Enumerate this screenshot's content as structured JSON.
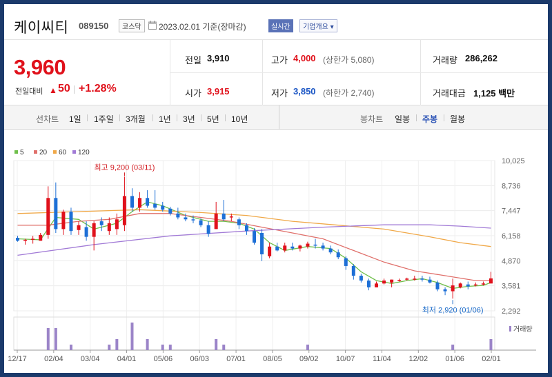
{
  "header": {
    "name": "케이씨티",
    "code": "089150",
    "market": "코스닥",
    "date": "2023.02.01 기준(장마감)",
    "realtime_label": "실시간",
    "company_label": "기업개요"
  },
  "summary": {
    "price": "3,960",
    "change_label": "전일대비",
    "change_value": "50",
    "change_pct": "+1.28%",
    "prev_close_label": "전일",
    "prev_close": "3,910",
    "high_label": "고가",
    "high": "4,000",
    "upper_limit": "(상한가 5,080)",
    "volume_label": "거래량",
    "volume": "286,262",
    "open_label": "시가",
    "open": "3,915",
    "low_label": "저가",
    "low": "3,850",
    "lower_limit": "(하한가 2,740)",
    "amount_label": "거래대금",
    "amount": "1,125 백만"
  },
  "range_bar": {
    "line_label": "선차트",
    "line_options": [
      "1일",
      "1주일",
      "3개월",
      "1년",
      "3년",
      "5년",
      "10년"
    ],
    "candle_label": "봉차트",
    "candle_options": [
      "일봉",
      "주봉",
      "월봉"
    ],
    "active_candle": "주봉"
  },
  "colors": {
    "up": "#e0111b",
    "down": "#1d6fd6",
    "ma5": "#6fbf4a",
    "ma20": "#e0706b",
    "ma60": "#f0a848",
    "ma120": "#a17ad6",
    "volume": "#9b84c8"
  },
  "chart_data": {
    "type": "candlestick",
    "legend": [
      "5",
      "20",
      "60",
      "120"
    ],
    "y_ticks": [
      "10,025",
      "8,736",
      "7,447",
      "6,158",
      "4,870",
      "3,581",
      "2,292"
    ],
    "ylim": [
      2292,
      10025
    ],
    "x_ticks": [
      "12/17",
      "02/04",
      "03/04",
      "04/01",
      "05/06",
      "06/03",
      "07/01",
      "08/05",
      "09/02",
      "10/07",
      "11/04",
      "12/02",
      "01/06",
      "02/01"
    ],
    "annotation_high": "최고 9,200 (03/11)",
    "annotation_low": "최저 2,920 (01/06)",
    "volume_label": "거래량",
    "candles": [
      {
        "o": 6050,
        "h": 6150,
        "l": 5850,
        "c": 5900
      },
      {
        "o": 5900,
        "h": 6000,
        "l": 5700,
        "c": 5950
      },
      {
        "o": 5950,
        "h": 6150,
        "l": 5750,
        "c": 6000
      },
      {
        "o": 5900,
        "h": 6300,
        "l": 5900,
        "c": 6200
      },
      {
        "o": 6200,
        "h": 8700,
        "l": 6000,
        "c": 8100
      },
      {
        "o": 8100,
        "h": 8900,
        "l": 6300,
        "c": 6500
      },
      {
        "o": 6500,
        "h": 7500,
        "l": 6200,
        "c": 7400
      },
      {
        "o": 7400,
        "h": 7600,
        "l": 6200,
        "c": 6400
      },
      {
        "o": 6450,
        "h": 6900,
        "l": 6200,
        "c": 6700
      },
      {
        "o": 6600,
        "h": 6900,
        "l": 5900,
        "c": 6100
      },
      {
        "o": 6100,
        "h": 6900,
        "l": 5400,
        "c": 6800
      },
      {
        "o": 6900,
        "h": 7100,
        "l": 6400,
        "c": 6700
      },
      {
        "o": 6400,
        "h": 7100,
        "l": 6200,
        "c": 6800
      },
      {
        "o": 6500,
        "h": 7300,
        "l": 6200,
        "c": 7000
      },
      {
        "o": 6700,
        "h": 9200,
        "l": 6400,
        "c": 8200
      },
      {
        "o": 8200,
        "h": 8600,
        "l": 7400,
        "c": 7600
      },
      {
        "o": 7600,
        "h": 8400,
        "l": 7400,
        "c": 8100
      },
      {
        "o": 8100,
        "h": 8500,
        "l": 7600,
        "c": 7700
      },
      {
        "o": 7800,
        "h": 8500,
        "l": 7500,
        "c": 7600
      },
      {
        "o": 7700,
        "h": 7900,
        "l": 7400,
        "c": 7500
      },
      {
        "o": 7550,
        "h": 7650,
        "l": 7200,
        "c": 7300
      },
      {
        "o": 7300,
        "h": 7600,
        "l": 7000,
        "c": 7100
      },
      {
        "o": 7100,
        "h": 7300,
        "l": 6900,
        "c": 7000
      },
      {
        "o": 7000,
        "h": 7200,
        "l": 6800,
        "c": 6950
      },
      {
        "o": 6950,
        "h": 7050,
        "l": 6600,
        "c": 6700
      },
      {
        "o": 6700,
        "h": 6900,
        "l": 6100,
        "c": 6250
      },
      {
        "o": 6500,
        "h": 7900,
        "l": 6500,
        "c": 7300
      },
      {
        "o": 7300,
        "h": 8000,
        "l": 6900,
        "c": 7000
      },
      {
        "o": 7100,
        "h": 7300,
        "l": 6900,
        "c": 7150
      },
      {
        "o": 7000,
        "h": 7100,
        "l": 6500,
        "c": 6700
      },
      {
        "o": 6700,
        "h": 6800,
        "l": 6200,
        "c": 6400
      },
      {
        "o": 6400,
        "h": 6550,
        "l": 5700,
        "c": 5800
      },
      {
        "o": 6300,
        "h": 6500,
        "l": 4850,
        "c": 5200
      },
      {
        "o": 5100,
        "h": 5800,
        "l": 5000,
        "c": 5600
      },
      {
        "o": 5600,
        "h": 5800,
        "l": 5350,
        "c": 5400
      },
      {
        "o": 5400,
        "h": 5800,
        "l": 5300,
        "c": 5650
      },
      {
        "o": 5600,
        "h": 5800,
        "l": 5400,
        "c": 5500
      },
      {
        "o": 5500,
        "h": 5700,
        "l": 5350,
        "c": 5650
      },
      {
        "o": 5600,
        "h": 5850,
        "l": 5500,
        "c": 5750
      },
      {
        "o": 5700,
        "h": 6000,
        "l": 5500,
        "c": 5650
      },
      {
        "o": 5650,
        "h": 5800,
        "l": 5400,
        "c": 5500
      },
      {
        "o": 5500,
        "h": 5650,
        "l": 5200,
        "c": 5300
      },
      {
        "o": 5300,
        "h": 5450,
        "l": 4950,
        "c": 5050
      },
      {
        "o": 5000,
        "h": 5100,
        "l": 4400,
        "c": 4600
      },
      {
        "o": 4600,
        "h": 4700,
        "l": 3900,
        "c": 4100
      },
      {
        "o": 4100,
        "h": 4200,
        "l": 3750,
        "c": 3850
      },
      {
        "o": 3850,
        "h": 3950,
        "l": 3350,
        "c": 3500
      },
      {
        "o": 3500,
        "h": 3800,
        "l": 3500,
        "c": 3700
      },
      {
        "o": 3700,
        "h": 3950,
        "l": 3650,
        "c": 3850
      },
      {
        "o": 3750,
        "h": 3900,
        "l": 3500,
        "c": 3900
      },
      {
        "o": 3850,
        "h": 3950,
        "l": 3800,
        "c": 3880
      },
      {
        "o": 3900,
        "h": 4000,
        "l": 3850,
        "c": 3950
      },
      {
        "o": 3900,
        "h": 4100,
        "l": 3850,
        "c": 3950
      },
      {
        "o": 3950,
        "h": 4100,
        "l": 3800,
        "c": 3900
      },
      {
        "o": 3900,
        "h": 4050,
        "l": 3700,
        "c": 3750
      },
      {
        "o": 3750,
        "h": 3850,
        "l": 3300,
        "c": 3400
      },
      {
        "o": 3400,
        "h": 3500,
        "l": 3100,
        "c": 3300
      },
      {
        "o": 3300,
        "h": 3950,
        "l": 2920,
        "c": 3600
      },
      {
        "o": 3500,
        "h": 3750,
        "l": 3450,
        "c": 3700
      },
      {
        "o": 3650,
        "h": 3800,
        "l": 3400,
        "c": 3550
      },
      {
        "o": 3600,
        "h": 3750,
        "l": 3550,
        "c": 3650
      },
      {
        "o": 3650,
        "h": 3800,
        "l": 3600,
        "c": 3700
      },
      {
        "o": 3700,
        "h": 4300,
        "l": 3700,
        "c": 3960
      }
    ],
    "ma": {
      "ma5": [
        [
          0,
          6000
        ],
        [
          3,
          5950
        ],
        [
          5,
          7100
        ],
        [
          8,
          7000
        ],
        [
          10,
          6500
        ],
        [
          13,
          6800
        ],
        [
          15,
          7400
        ],
        [
          17,
          7900
        ],
        [
          19,
          7700
        ],
        [
          22,
          7200
        ],
        [
          25,
          6900
        ],
        [
          27,
          6900
        ],
        [
          29,
          6800
        ],
        [
          31,
          6500
        ],
        [
          33,
          5800
        ],
        [
          35,
          5400
        ],
        [
          38,
          5600
        ],
        [
          41,
          5500
        ],
        [
          43,
          5000
        ],
        [
          45,
          4300
        ],
        [
          47,
          3850
        ],
        [
          49,
          3700
        ],
        [
          51,
          3850
        ],
        [
          53,
          3950
        ],
        [
          55,
          3750
        ],
        [
          57,
          3450
        ],
        [
          59,
          3550
        ],
        [
          61,
          3600
        ],
        [
          62,
          3750
        ]
      ],
      "ma20": [
        [
          0,
          6700
        ],
        [
          4,
          6700
        ],
        [
          8,
          6900
        ],
        [
          12,
          7000
        ],
        [
          16,
          7300
        ],
        [
          20,
          7300
        ],
        [
          24,
          7100
        ],
        [
          28,
          6900
        ],
        [
          32,
          6600
        ],
        [
          36,
          6300
        ],
        [
          40,
          6000
        ],
        [
          44,
          5400
        ],
        [
          48,
          4800
        ],
        [
          52,
          4350
        ],
        [
          56,
          4100
        ],
        [
          60,
          3850
        ],
        [
          62,
          3850
        ]
      ],
      "ma60": [
        [
          0,
          7300
        ],
        [
          8,
          7400
        ],
        [
          16,
          7500
        ],
        [
          24,
          7350
        ],
        [
          30,
          7200
        ],
        [
          36,
          6900
        ],
        [
          42,
          6700
        ],
        [
          48,
          6500
        ],
        [
          54,
          6100
        ],
        [
          58,
          5800
        ],
        [
          62,
          5600
        ]
      ],
      "ma120": [
        [
          0,
          5150
        ],
        [
          10,
          5700
        ],
        [
          20,
          6150
        ],
        [
          30,
          6400
        ],
        [
          40,
          6600
        ],
        [
          48,
          6720
        ],
        [
          54,
          6720
        ],
        [
          58,
          6650
        ],
        [
          62,
          6550
        ]
      ]
    },
    "volume": [
      0,
      0,
      0,
      0,
      4,
      4,
      0,
      1,
      0,
      0,
      0,
      0,
      1,
      2,
      0,
      5,
      0,
      2,
      0,
      1,
      1,
      0,
      0,
      0,
      0,
      0,
      2,
      1,
      0,
      0,
      0,
      0,
      0,
      0,
      0,
      0,
      0,
      0,
      1,
      0,
      0,
      0,
      0,
      0,
      0,
      0,
      0,
      0,
      0,
      0,
      0,
      0,
      0,
      0,
      0,
      0,
      0,
      1,
      0,
      0,
      0,
      0,
      2
    ]
  }
}
